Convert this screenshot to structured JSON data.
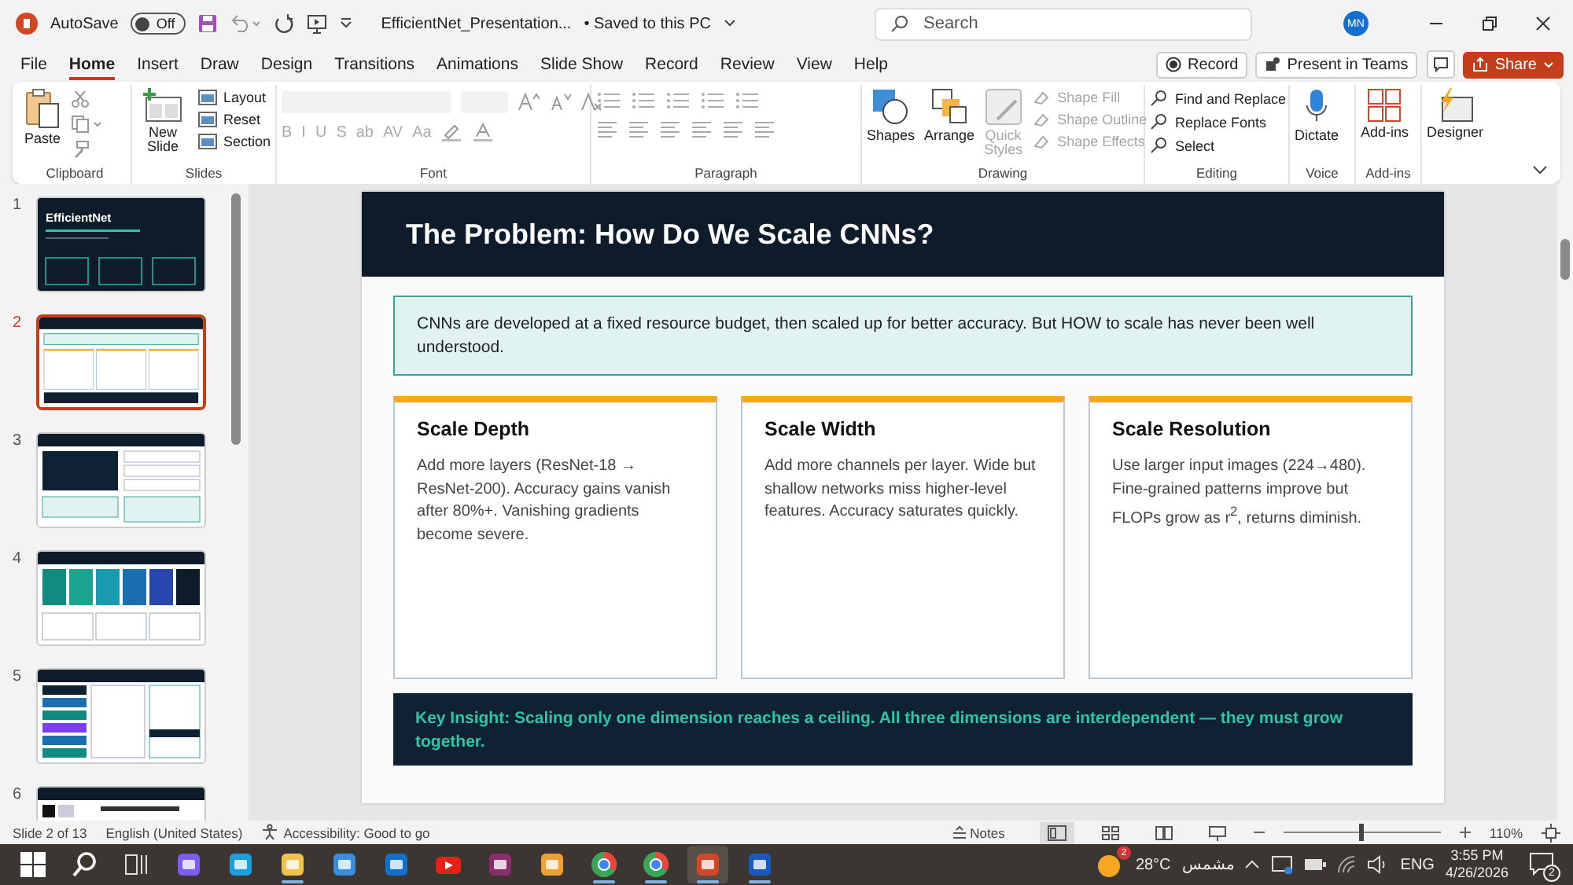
{
  "title_bar": {
    "autosave_label": "AutoSave",
    "autosave_toggle": {
      "on": false,
      "label": "Off"
    },
    "file_name": "EfficientNet_Presentation...",
    "save_status": "• Saved to this PC",
    "search": {
      "placeholder": "Search"
    },
    "avatar": "MN"
  },
  "menu_tabs": [
    {
      "label": "File",
      "selected": false
    },
    {
      "label": "Home",
      "selected": true
    },
    {
      "label": "Insert",
      "selected": false
    },
    {
      "label": "Draw",
      "selected": false
    },
    {
      "label": "Design",
      "selected": false
    },
    {
      "label": "Transitions",
      "selected": false
    },
    {
      "label": "Animations",
      "selected": false
    },
    {
      "label": "Slide Show",
      "selected": false
    },
    {
      "label": "Record",
      "selected": false
    },
    {
      "label": "Review",
      "selected": false
    },
    {
      "label": "View",
      "selected": false
    },
    {
      "label": "Help",
      "selected": false
    }
  ],
  "actions": {
    "record": "Record",
    "present": "Present in Teams",
    "share": "Share"
  },
  "ribbon": {
    "clipboard": {
      "label": "Clipboard",
      "paste": "Paste"
    },
    "slides": {
      "label": "Slides",
      "new_slide": "New Slide",
      "items": [
        "Layout",
        "Reset",
        "Section"
      ]
    },
    "font": {
      "label": "Font",
      "disabled": true,
      "format_buttons": [
        "B",
        "I",
        "U",
        "S",
        "ab",
        "AV",
        "Aa"
      ]
    },
    "paragraph": {
      "label": "Paragraph",
      "disabled": true
    },
    "drawing": {
      "label": "Drawing",
      "shapes": "Shapes",
      "arrange": "Arrange",
      "quick_styles": {
        "label": "Quick Styles",
        "disabled": true
      },
      "options": [
        {
          "label": "Shape Fill",
          "disabled": true
        },
        {
          "label": "Shape Outline",
          "disabled": true
        },
        {
          "label": "Shape Effects",
          "disabled": true
        }
      ]
    },
    "editing": {
      "label": "Editing",
      "items": [
        "Find and Replace",
        "Replace Fonts",
        "Select"
      ]
    },
    "voice": {
      "label": "Voice",
      "dictate": "Dictate"
    },
    "addins": {
      "label": "Add-ins",
      "button": "Add-ins"
    },
    "designer": {
      "button": "Designer"
    }
  },
  "thumbnails": [
    {
      "number": "1",
      "kind": "title",
      "title": "EfficientNet",
      "selected": false
    },
    {
      "number": "2",
      "kind": "cards",
      "selected": true
    },
    {
      "number": "3",
      "kind": "code",
      "selected": false
    },
    {
      "number": "4",
      "kind": "grid",
      "selected": false
    },
    {
      "number": "5",
      "kind": "columns",
      "selected": false
    },
    {
      "number": "6",
      "kind": "image",
      "selected": false
    }
  ],
  "slide": {
    "title": "The Problem: How Do We Scale CNNs?",
    "intro": "CNNs are developed at a fixed resource budget, then scaled up for better accuracy. But HOW to scale has never been well understood.",
    "cards": [
      {
        "title": "Scale Depth",
        "body": "Add more layers (ResNet-18 → ResNet-200). Accuracy gains vanish after 80%+. Vanishing gradients become severe."
      },
      {
        "title": "Scale Width",
        "body": "Add more channels per layer. Wide but shallow networks miss higher-level features. Accuracy saturates quickly."
      },
      {
        "title": "Scale Resolution",
        "body": "Use larger input images (224→480). Fine-grained patterns improve but FLOPs grow as r$^{2}$, returns diminish."
      }
    ],
    "insight": "Key Insight: Scaling only one dimension reaches a ceiling. All three dimensions are interdependent — they must grow together."
  },
  "status_bar": {
    "slide_count": "Slide 2 of 13",
    "language": "English (United States)",
    "accessibility": "Accessibility: Good to go",
    "notes": "Notes",
    "views": [
      {
        "kind": "normal",
        "selected": true
      },
      {
        "kind": "sorter",
        "selected": false
      },
      {
        "kind": "reading",
        "selected": false
      },
      {
        "kind": "slideshow",
        "selected": false
      }
    ],
    "zoom": {
      "level": 0.5,
      "reading": "110%"
    }
  },
  "taskbar": {
    "apps": [
      {
        "kind": "start",
        "running": false,
        "selected": false
      },
      {
        "kind": "search",
        "running": false,
        "selected": false
      },
      {
        "kind": "taskview",
        "running": false,
        "selected": false
      },
      {
        "kind": "copilot",
        "running": false,
        "selected": false
      },
      {
        "kind": "edge",
        "running": false,
        "selected": false
      },
      {
        "kind": "explorer",
        "running": true,
        "selected": false
      },
      {
        "kind": "store",
        "running": false,
        "selected": false
      },
      {
        "kind": "outlook",
        "running": false,
        "selected": false
      },
      {
        "kind": "youtube",
        "running": false,
        "selected": false
      },
      {
        "kind": "archive",
        "running": false,
        "selected": false
      },
      {
        "kind": "shield",
        "running": false,
        "selected": false
      },
      {
        "kind": "chrome",
        "running": true,
        "selected": false
      },
      {
        "kind": "chrome",
        "running": true,
        "selected": false
      },
      {
        "kind": "powerpoint",
        "running": true,
        "selected": true
      },
      {
        "kind": "word",
        "running": true,
        "selected": false
      }
    ],
    "weather_badge": "2",
    "temperature": "28°C",
    "condition": "مشمس",
    "language": "ENG",
    "time": "3:55 PM",
    "date": "4/26/2026",
    "notifications": "2"
  }
}
